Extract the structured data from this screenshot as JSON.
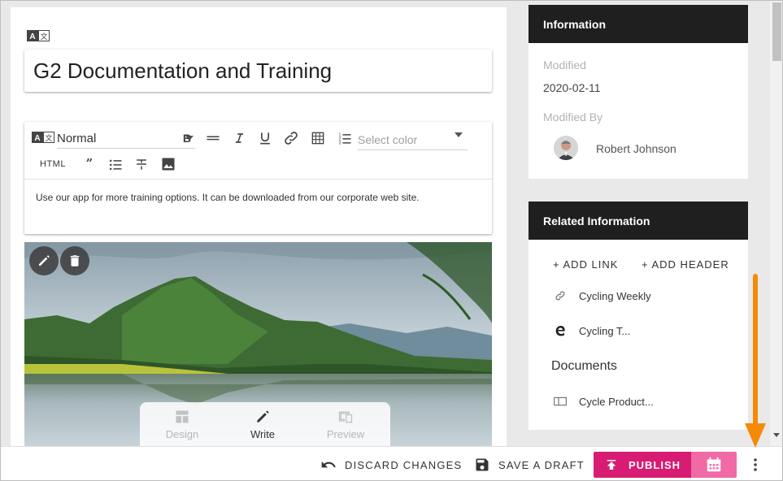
{
  "editor": {
    "title": "G2 Documentation and Training",
    "toolbar": {
      "format": "Normal",
      "color_placeholder": "Select color",
      "html_label": "HTML"
    },
    "body_text": "Use our app for more training options. It can be downloaded from our corporate web site.",
    "mode_switch": {
      "design": "Design",
      "write": "Write",
      "preview": "Preview",
      "active": "Write"
    }
  },
  "info_panel": {
    "header": "Information",
    "modified_label": "Modified",
    "modified_value": "2020-02-11",
    "modified_by_label": "Modified By",
    "modified_by_value": "Robert Johnson"
  },
  "related_panel": {
    "header": "Related Information",
    "add_link": "ADD LINK",
    "add_header": "ADD HEADER",
    "items": [
      {
        "icon": "link-icon",
        "label": "Cycling Weekly"
      },
      {
        "icon": "edge-browser-icon",
        "label": "Cycling T..."
      }
    ],
    "documents_heading": "Documents",
    "documents": [
      {
        "icon": "document-view-icon",
        "label": "Cycle Product..."
      }
    ]
  },
  "bottom_bar": {
    "discard": "DISCARD CHANGES",
    "save_draft": "SAVE A DRAFT",
    "publish": "PUBLISH"
  },
  "colors": {
    "publish": "#d81b73",
    "schedule": "#f06aa5",
    "panel_header": "#1f1f1f",
    "annotation_arrow": "#f58a07"
  }
}
